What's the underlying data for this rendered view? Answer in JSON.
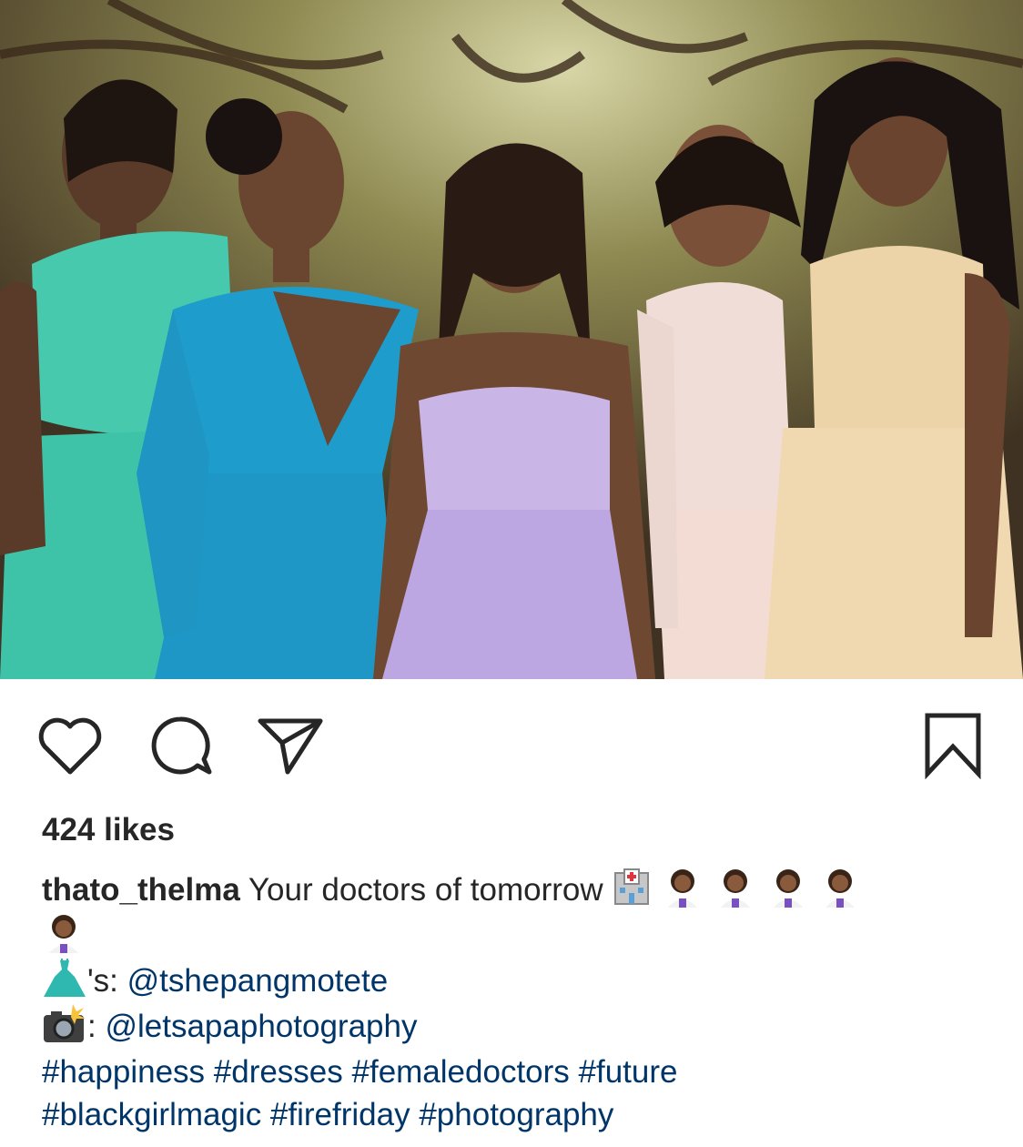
{
  "post": {
    "photo": {
      "name": "group-photo"
    },
    "actions": {
      "like_icon": "heart-icon",
      "comment_icon": "comment-bubble-icon",
      "share_icon": "paper-plane-icon",
      "save_icon": "bookmark-icon"
    },
    "likes_text": "424 likes",
    "caption": {
      "username": "thato_thelma",
      "text": "Your doctors of tomorrow",
      "line1_emojis": [
        "hospital-emoji",
        "woman-health-worker-emoji",
        "woman-health-worker-emoji",
        "woman-health-worker-emoji",
        "woman-health-worker-emoji",
        "woman-health-worker-emoji"
      ],
      "dress_credit_suffix": "'s:",
      "dress_mention": "@tshepangmotete",
      "camera_credit_suffix": ":",
      "camera_mention": "@letsapaphotography",
      "hashtags_line1": "#happiness #dresses #femaledoctors #future",
      "hashtags_line2": "#blackgirlmagic #firefriday #photography"
    },
    "colors": {
      "text": "#262626",
      "link": "#003569",
      "background": "#ffffff"
    }
  }
}
